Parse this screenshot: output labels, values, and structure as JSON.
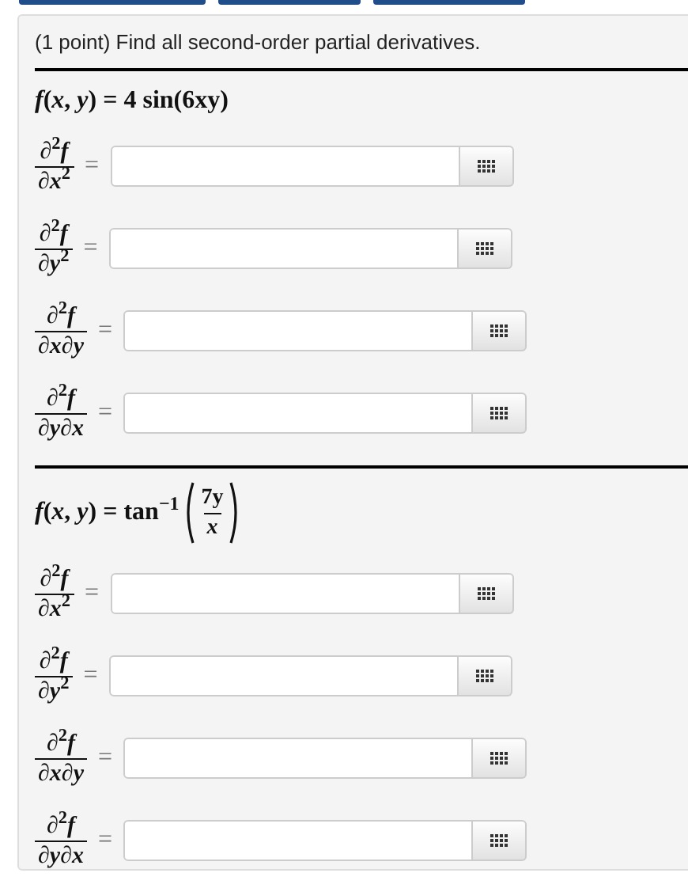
{
  "top_buttons": [
    {
      "kind": "cut_off"
    },
    {
      "kind": "cut_off"
    },
    {
      "kind": "cut_off"
    }
  ],
  "problem": {
    "statement": "(1 point) Find all second-order partial derivatives."
  },
  "parts": [
    {
      "kind": "plain",
      "formula": "*f*(*x*, *y*) = 4 sin(6xy)",
      "answers": [
        {
          "numerator": "∂$^{2}$*f*",
          "denominator": "∂*x*$^{2}$",
          "equals": "="
        },
        {
          "numerator": "∂$^{2}$*f*",
          "denominator": "∂*y*$^{2}$",
          "equals": "="
        },
        {
          "numerator": "∂$^{2}$*f*",
          "denominator": "∂*x*∂*y*",
          "equals": "="
        },
        {
          "numerator": "∂$^{2}$*f*",
          "denominator": "∂*y*∂*x*",
          "equals": "="
        }
      ]
    },
    {
      "kind": "fraction_argument",
      "formula": "*f*(*x*, *y*) = tan$^{−1}$",
      "argument": {
        "numerator": "7y",
        "denominator": "*x*"
      },
      "answers": [
        {
          "numerator": "∂$^{2}$*f*",
          "denominator": "∂*x*$^{2}$",
          "equals": "="
        },
        {
          "numerator": "∂$^{2}$*f*",
          "denominator": "∂*y*$^{2}$",
          "equals": "="
        },
        {
          "numerator": "∂$^{2}$*f*",
          "denominator": "∂*x*∂*y*",
          "equals": "="
        },
        {
          "numerator": "∂$^{2}$*f*",
          "denominator": "∂*y*∂*x*",
          "equals": "="
        }
      ]
    }
  ]
}
